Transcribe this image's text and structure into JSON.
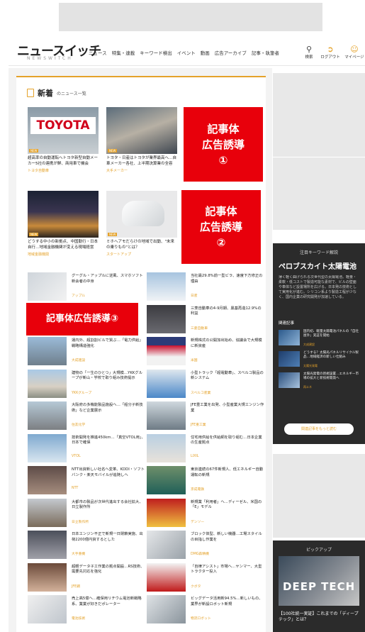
{
  "header": {
    "logo_text": "ニュースイッチ",
    "logo_sub": "NEWSWITCH",
    "nav": [
      "ニュース",
      "特集・連載",
      "キーワード検出",
      "イベント",
      "動画",
      "広告アーカイブ",
      "記事・執筆者"
    ],
    "icons": [
      {
        "label": "検索",
        "icon": "search-icon"
      },
      {
        "label": "ログアウト",
        "icon": "logout-icon"
      },
      {
        "label": "マイページ",
        "icon": "user-icon"
      }
    ]
  },
  "section": {
    "title": "新着",
    "subtitle": "のニュース一覧"
  },
  "new_badge": "NEW",
  "cards": [
    {
      "caption": "超高率の自動運転へトヨタ新型自動メーカー5社の連携が鮮、商用車で機会",
      "tag": "トヨタ自動車",
      "img": "toyota",
      "logo": "TOYOTA"
    },
    {
      "caption": "トヨタ・日産はトヨタが業界最高へ…自車メーカー各社、上半期決算業の全容",
      "tag": "大手メーカー",
      "img": "factory"
    },
    {
      "caption": "どうする中小の新拠点、中国勤行・日本自行…地域金融機関が変える現場経営",
      "tag": "地域金融機関",
      "img": "city"
    },
    {
      "caption": "ミホヘアモだらけの地域で出動、\"未来の乗りもの\"とは？",
      "tag": "スタートアップ",
      "img": "device"
    }
  ],
  "red_ads": [
    "記事体\n広告誘導\n①",
    "記事体\n広告誘導\n②",
    "記事体広告誘導③"
  ],
  "list_left": [
    {
      "text": "グーグル・アップルに逆風、スマホソフト新会者の中身",
      "tag": "アップル",
      "img": "phone"
    },
    {
      "text": "",
      "tag": "",
      "img": "none"
    },
    {
      "text": "運内外、超割割ビルで質ぶ…「電力供給」戦略構造強化",
      "tag": "大成建設",
      "img": "building"
    },
    {
      "text": "建物の「一生のひとつ」大規模…YKKグループが新山・学校で取り組み技術提示",
      "tag": "YKKグループ",
      "img": "house"
    },
    {
      "text": "大阪府の多機能製品施設へ…「船分子新技術」など企業展示",
      "tag": "住友化学",
      "img": "plant"
    },
    {
      "text": "技術開発を推進450km…「真空VTOL用」、日本で確保",
      "tag": "VTOL",
      "img": "plane"
    },
    {
      "text": "NTT出資新しい社名へ変革、KDDI・ソフトバンク・楽天モバイルが追随しへ",
      "tag": "NTT",
      "img": "meeting"
    },
    {
      "text": "大都市の製品が次世代進出する会社拡大、日立製作所",
      "tag": "日立製作所",
      "img": "station"
    },
    {
      "text": "日本エンジン不正で新規一日閉鎖実施、出荷2200億円資するとした",
      "tag": "大手重機",
      "img": "crowd"
    },
    {
      "text": "超軽データ子工作業の拠点開設…RS技術、需要先対応を強化",
      "tag": "JFE鋼",
      "img": "tube"
    },
    {
      "text": "売上高5億ヘ…確保用リチウム電池新戦略系、業業が好きだポレーター",
      "tag": "電池技術",
      "img": "roll"
    }
  ],
  "list_right": [
    {
      "text": "当社最29.8%前一型ビラ、速度下方修正の理由",
      "tag": "日産",
      "img": "tower"
    },
    {
      "text": "三菱自動車の4-9月期、黒基再造12.9%の利益",
      "tag": "三菱自動車",
      "img": "mitsubishi"
    },
    {
      "text": "新規株式の公開加出始め、協議会で大規模に新資産",
      "tag": "米国",
      "img": "flag"
    },
    {
      "text": "小型トラック「超電動車」、スベルコ製品の新システム",
      "tag": "スベルコ産業",
      "img": "truck"
    },
    {
      "text": "JFE重工業を出発、小型産業大規エンジン作業",
      "tag": "JFE重工業",
      "img": "drone"
    },
    {
      "text": "住宅用供給を供給網を取り組む…日本企業の生産拠点",
      "tag": "LIXIL",
      "img": "homes"
    },
    {
      "text": "東京連続の67件新規人、低エネルギー自動運転の新規",
      "tag": "京成電鉄",
      "img": "train"
    },
    {
      "text": "新規業「利用者」ヘ…ディーゼル、米国の「E」モデル",
      "tag": "デンソー",
      "img": "sign"
    },
    {
      "text": "ブロック体型、新しい機器…工場スタイルの目指し作業を",
      "tag": "DMG森精機",
      "img": "machine"
    },
    {
      "text": "「自律アシスト」市場へ…ヤンマー、大型トラクター投入",
      "tag": "クボタ",
      "img": "tractor"
    },
    {
      "text": "ビッグデータ活用新94.5%…新しいもの、業界が新設ロボット新規",
      "tag": "物流ロボット",
      "img": "robot"
    }
  ],
  "keyword_box": {
    "heading": "注目キーワード解説",
    "title": "ペロブスカイト太陽電池",
    "body": "薄く軽く曲げられる次世代型の太陽電池。軽量・柔軟・低コストで製造可能な素材で、ビルの壁面や車体など設置場所を広げる。日本発の技術として実用化が進む。シリコン系より製造工程が少なく、国内企業の研究開発が加速している。",
    "related": "関連記事",
    "items": [
      {
        "text": "国内初、軽量太陽電池パネルの「自社屋外」実証を開始",
        "tag": "大成建設"
      },
      {
        "text": "どうする？太陽光パネルリサイクル製品…地域経済の新しい仕組み",
        "tag": "太陽光発電"
      },
      {
        "text": "太陽光発電の新規設置…エネルギー市場の拡大と新技術開発へ",
        "tag": "再エネ"
      }
    ],
    "button": "関連記事をもっと読む"
  },
  "pickup": {
    "heading": "ピックアップ",
    "big": "DEEP TECH",
    "text": "【100社統一実証】これまでの「ディープテック」とは？"
  }
}
